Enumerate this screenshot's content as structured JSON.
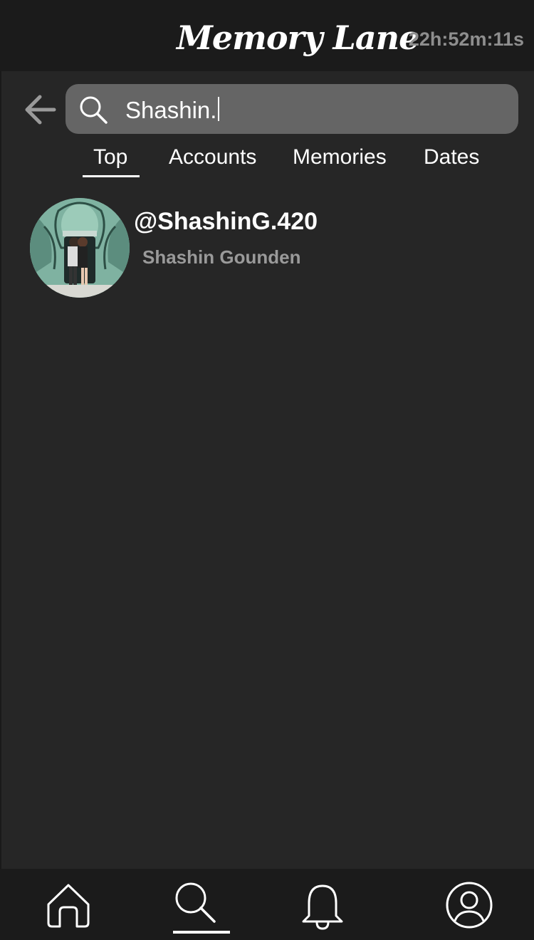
{
  "header": {
    "title": "Memory Lane",
    "timer": "22h:52m:11s"
  },
  "search": {
    "query": "Shashin.",
    "back_icon": "arrow-left-icon",
    "icon": "search-icon"
  },
  "tabs": [
    {
      "label": "Top",
      "active": true
    },
    {
      "label": "Accounts",
      "active": false
    },
    {
      "label": "Memories",
      "active": false
    },
    {
      "label": "Dates",
      "active": false
    }
  ],
  "results": [
    {
      "handle": "@ShashinG.420",
      "name": "Shashin Gounden"
    }
  ],
  "nav": [
    {
      "icon": "home-icon",
      "active": false
    },
    {
      "icon": "search-icon",
      "active": true
    },
    {
      "icon": "bell-icon",
      "active": false
    },
    {
      "icon": "profile-icon",
      "active": false
    }
  ],
  "colors": {
    "bar_bg": "#1b1b1b",
    "content_bg": "#262626",
    "search_bg": "#656565",
    "muted_text": "#9a9a9a",
    "timer_text": "#8e8e8e"
  }
}
